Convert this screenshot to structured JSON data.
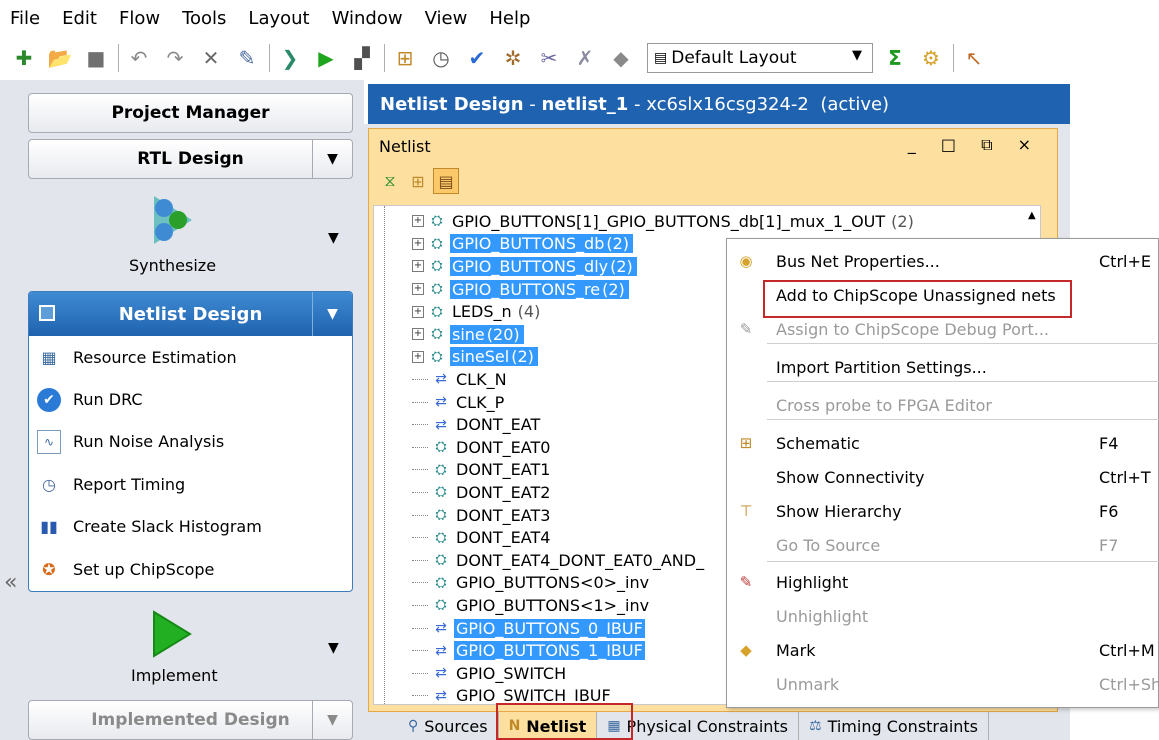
{
  "menubar": [
    "File",
    "Edit",
    "Flow",
    "Tools",
    "Layout",
    "Window",
    "View",
    "Help"
  ],
  "toolbar": {
    "layout_select": "Default Layout",
    "icons": [
      "new-project-icon",
      "open-project-icon",
      "save-icon",
      "undo-icon",
      "redo-icon",
      "delete-icon",
      "run-icon",
      "synthesize-icon",
      "implement-icon",
      "bitstream-icon",
      "schematic-icon",
      "timing-icon",
      "check-icon",
      "settings-icon",
      "tools-icon",
      "wand-icon",
      "diamond-icon",
      "sigma-icon",
      "config-icon",
      "cursor-icon"
    ]
  },
  "flow": {
    "project_manager": "Project Manager",
    "rtl_design": "RTL Design",
    "synthesize": "Synthesize",
    "netlist_design": "Netlist Design",
    "tasks": [
      "Resource Estimation",
      "Run DRC",
      "Run Noise Analysis",
      "Report Timing",
      "Create Slack Histogram",
      "Set up ChipScope"
    ],
    "implement": "Implement",
    "implemented_design": "Implemented Design"
  },
  "main": {
    "title_bold": "Netlist Design",
    "title_sep": " - ",
    "title_name": "netlist_1",
    "title_rest": " - xc6slx16csg324-2  (active)"
  },
  "netlist": {
    "panel_title": "Netlist",
    "window_controls": "_ □ ⧉ ×",
    "rows": [
      {
        "label": "GPIO_BUTTONS[1]_GPIO_BUTTONS_db[1]_mux_1_OUT",
        "count": "(2)",
        "expand": true,
        "selected": false,
        "type": "bus"
      },
      {
        "label": "GPIO_BUTTONS_db",
        "count": "(2)",
        "expand": true,
        "selected": true,
        "type": "bus"
      },
      {
        "label": "GPIO_BUTTONS_dly",
        "count": "(2)",
        "expand": true,
        "selected": true,
        "type": "bus"
      },
      {
        "label": "GPIO_BUTTONS_re",
        "count": "(2)",
        "expand": true,
        "selected": true,
        "type": "bus"
      },
      {
        "label": "LEDS_n",
        "count": "(4)",
        "expand": true,
        "selected": false,
        "type": "bus"
      },
      {
        "label": "sine",
        "count": "(20)",
        "expand": true,
        "selected": true,
        "type": "bus"
      },
      {
        "label": "sineSel",
        "count": "(2)",
        "expand": true,
        "selected": true,
        "type": "bus"
      },
      {
        "label": "CLK_N",
        "count": "",
        "expand": false,
        "selected": false,
        "type": "port"
      },
      {
        "label": "CLK_P",
        "count": "",
        "expand": false,
        "selected": false,
        "type": "port"
      },
      {
        "label": "DONT_EAT",
        "count": "",
        "expand": false,
        "selected": false,
        "type": "port"
      },
      {
        "label": "DONT_EAT0",
        "count": "",
        "expand": false,
        "selected": false,
        "type": "net"
      },
      {
        "label": "DONT_EAT1",
        "count": "",
        "expand": false,
        "selected": false,
        "type": "net"
      },
      {
        "label": "DONT_EAT2",
        "count": "",
        "expand": false,
        "selected": false,
        "type": "net"
      },
      {
        "label": "DONT_EAT3",
        "count": "",
        "expand": false,
        "selected": false,
        "type": "net"
      },
      {
        "label": "DONT_EAT4",
        "count": "",
        "expand": false,
        "selected": false,
        "type": "net"
      },
      {
        "label": "DONT_EAT4_DONT_EAT0_AND_",
        "count": "",
        "expand": false,
        "selected": false,
        "type": "net"
      },
      {
        "label": "GPIO_BUTTONS<0>_inv",
        "count": "",
        "expand": false,
        "selected": false,
        "type": "net"
      },
      {
        "label": "GPIO_BUTTONS<1>_inv",
        "count": "",
        "expand": false,
        "selected": false,
        "type": "net"
      },
      {
        "label": "GPIO_BUTTONS_0_IBUF",
        "count": "",
        "expand": false,
        "selected": true,
        "type": "port"
      },
      {
        "label": "GPIO_BUTTONS_1_IBUF",
        "count": "",
        "expand": false,
        "selected": true,
        "type": "port"
      },
      {
        "label": "GPIO_SWITCH",
        "count": "",
        "expand": false,
        "selected": false,
        "type": "port"
      },
      {
        "label": "GPIO_SWITCH_IBUF",
        "count": "",
        "expand": false,
        "selected": false,
        "type": "port"
      }
    ]
  },
  "bottom_tabs": [
    "Sources",
    "Netlist",
    "Physical Constraints",
    "Timing Constraints"
  ],
  "context_menu": {
    "items": [
      {
        "label": "Bus Net Properties...",
        "shortcut": "Ctrl+E",
        "disabled": false,
        "icon": "properties-icon"
      },
      {
        "label": "Add to ChipScope Unassigned nets",
        "shortcut": "",
        "disabled": false,
        "icon": ""
      },
      {
        "label": "Assign to ChipScope Debug Port...",
        "shortcut": "",
        "disabled": true,
        "icon": "assign-icon"
      },
      {
        "label": "Import Partition Settings...",
        "shortcut": "",
        "disabled": false,
        "icon": ""
      },
      {
        "label": "Cross probe to FPGA Editor",
        "shortcut": "",
        "disabled": true,
        "icon": ""
      },
      {
        "label": "Schematic",
        "shortcut": "F4",
        "disabled": false,
        "icon": "schematic-icon"
      },
      {
        "label": "Show Connectivity",
        "shortcut": "Ctrl+T",
        "disabled": false,
        "icon": ""
      },
      {
        "label": "Show Hierarchy",
        "shortcut": "F6",
        "disabled": false,
        "icon": "hierarchy-icon"
      },
      {
        "label": "Go To Source",
        "shortcut": "F7",
        "disabled": true,
        "icon": ""
      },
      {
        "label": "Highlight",
        "shortcut": "",
        "disabled": false,
        "icon": "highlight-icon"
      },
      {
        "label": "Unhighlight",
        "shortcut": "",
        "disabled": true,
        "icon": ""
      },
      {
        "label": "Mark",
        "shortcut": "Ctrl+M",
        "disabled": false,
        "icon": "mark-icon"
      },
      {
        "label": "Unmark",
        "shortcut": "Ctrl+Sh",
        "disabled": true,
        "icon": ""
      }
    ]
  }
}
